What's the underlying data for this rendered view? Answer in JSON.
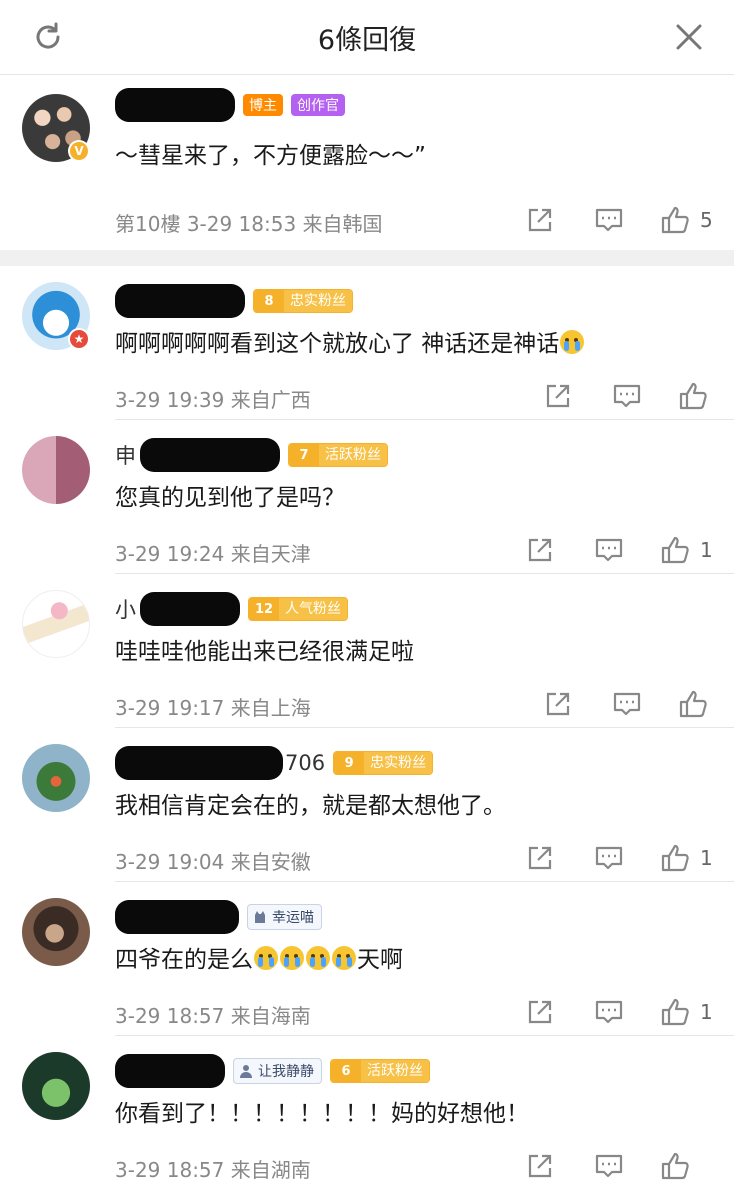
{
  "header": {
    "title": "6條回復"
  },
  "comments": [
    {
      "name_visible": "",
      "badges": {
        "role1": "博主",
        "role2": "创作官"
      },
      "text": "～彗星来了，不方便露脸～～”",
      "floor": "第10樓",
      "time": "3-29 18:53",
      "location": "来自韩国",
      "likes": "5"
    },
    {
      "name_visible": "",
      "fan_level": "8",
      "fan_label": "忠实粉丝",
      "text": "啊啊啊啊啊看到这个就放心了 神话还是神话",
      "time": "3-29 19:39",
      "location": "来自广西",
      "likes": ""
    },
    {
      "name_visible": "申",
      "fan_level": "7",
      "fan_label": "活跃粉丝",
      "text": "您真的见到他了是吗？",
      "time": "3-29 19:24",
      "location": "来自天津",
      "likes": "1"
    },
    {
      "name_visible": "小",
      "fan_level": "12",
      "fan_label": "人气粉丝",
      "text": "哇哇哇他能出来已经很满足啦",
      "time": "3-29 19:17",
      "location": "来自上海",
      "likes": ""
    },
    {
      "name_visible": "706",
      "fan_level": "9",
      "fan_label": "忠实粉丝",
      "text": "我相信肯定会在的，就是都太想他了。",
      "time": "3-29 19:04",
      "location": "来自安徽",
      "likes": "1"
    },
    {
      "name_visible": "",
      "tag_label": "幸运喵",
      "text_before": "四爷在的是么",
      "text_after": "天啊",
      "time": "3-29 18:57",
      "location": "来自海南",
      "likes": "1"
    },
    {
      "name_visible": "",
      "tag_label": "让我静静",
      "fan_level": "6",
      "fan_label": "活跃粉丝",
      "text": "你看到了！！！！！！！！妈的好想他！",
      "time": "3-29 18:57",
      "location": "来自湖南",
      "likes": ""
    }
  ],
  "colors": {
    "fan_badge": "#f5b12a",
    "role_orange": "#ff8a00",
    "role_purple": "#b460f0",
    "vip_gold": "#f5b12a"
  },
  "icons": [
    "refresh-icon",
    "close-icon",
    "share-icon",
    "reply-icon",
    "like-icon"
  ]
}
